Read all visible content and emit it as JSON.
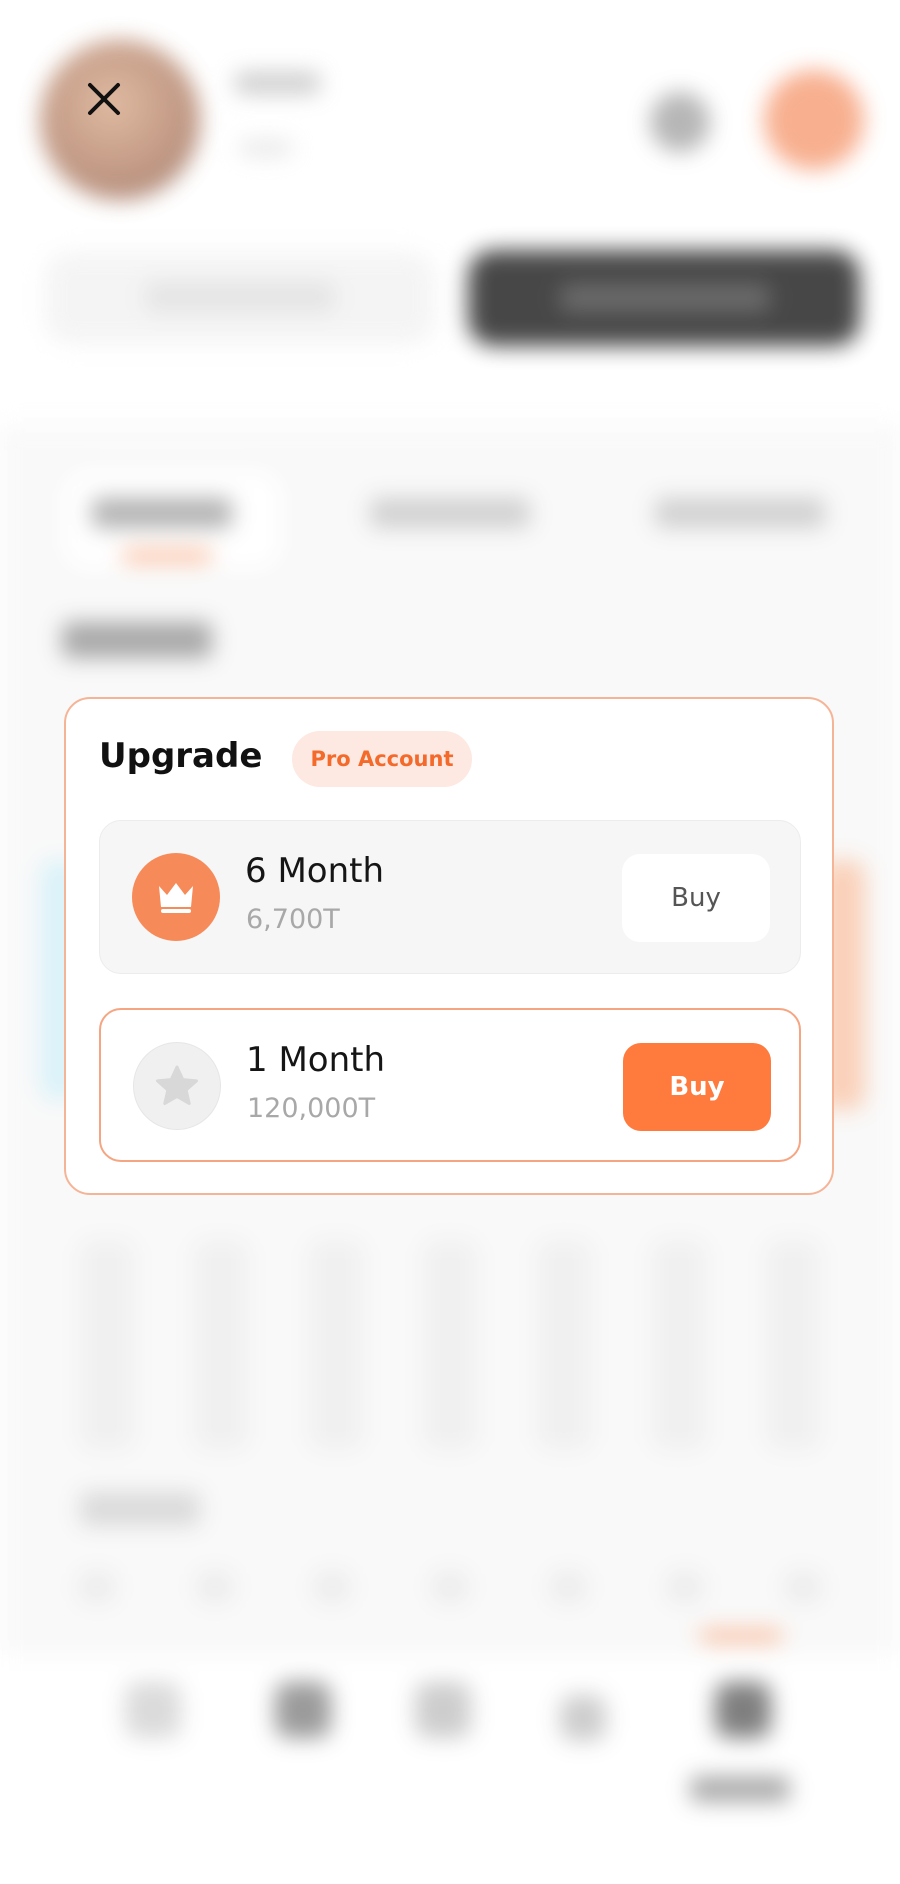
{
  "modal": {
    "title": "Upgrade",
    "badge": "Pro Account",
    "plans": [
      {
        "name": "6 Month",
        "price": "6,700T",
        "icon": "crown-icon",
        "button_label": "Buy"
      },
      {
        "name": "1 Month",
        "price": "120,000T",
        "icon": "star-icon",
        "button_label": "Buy"
      }
    ]
  },
  "header": {
    "close_icon": "close-icon"
  },
  "colors": {
    "accent": "#ff7a3d",
    "accent_light": "#fde8e2",
    "modal_border": "#f6b497",
    "crown_circle": "#f78a59",
    "text_primary": "#111111",
    "text_muted": "#a8a8a8"
  }
}
